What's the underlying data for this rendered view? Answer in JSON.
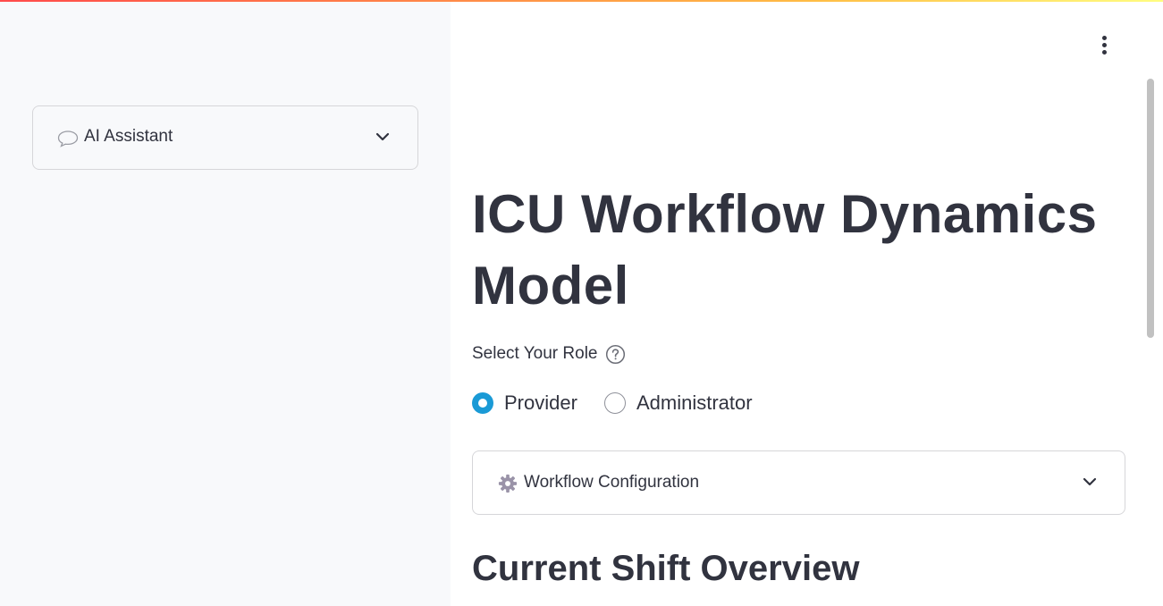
{
  "sidebar": {
    "assistant_expander": {
      "label": "AI Assistant",
      "icon": "chat-bubble-icon"
    }
  },
  "header": {
    "menu_icon": "kebab-menu-icon"
  },
  "main": {
    "title": "ICU Workflow Dynamics Model",
    "role_selector": {
      "label": "Select Your Role",
      "help_icon": "question-circle-icon",
      "options": [
        {
          "label": "Provider",
          "selected": true
        },
        {
          "label": "Administrator",
          "selected": false
        }
      ]
    },
    "workflow_expander": {
      "label": "Workflow Configuration",
      "icon": "gear-icon"
    },
    "section_heading": "Current Shift Overview"
  },
  "colors": {
    "accent": "#1a9ad6",
    "sidebar_bg": "#f8f9fb",
    "text": "#31333f",
    "border": "#d6d6d9"
  }
}
